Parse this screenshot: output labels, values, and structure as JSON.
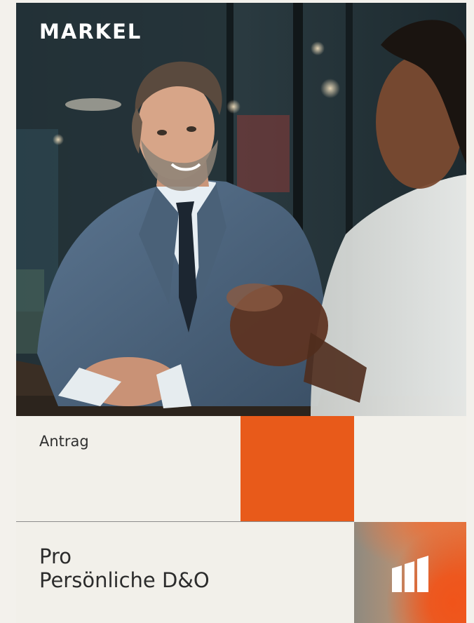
{
  "brand": {
    "logo_text": "MARKEL"
  },
  "document": {
    "type_label": "Antrag",
    "title_line1": "Pro",
    "title_line2": "Persönliche D&O"
  },
  "colors": {
    "accent_orange": "#e85a1a",
    "background": "#f2f0ea"
  },
  "icons": {
    "brand_mark": "markel-bars-icon"
  }
}
